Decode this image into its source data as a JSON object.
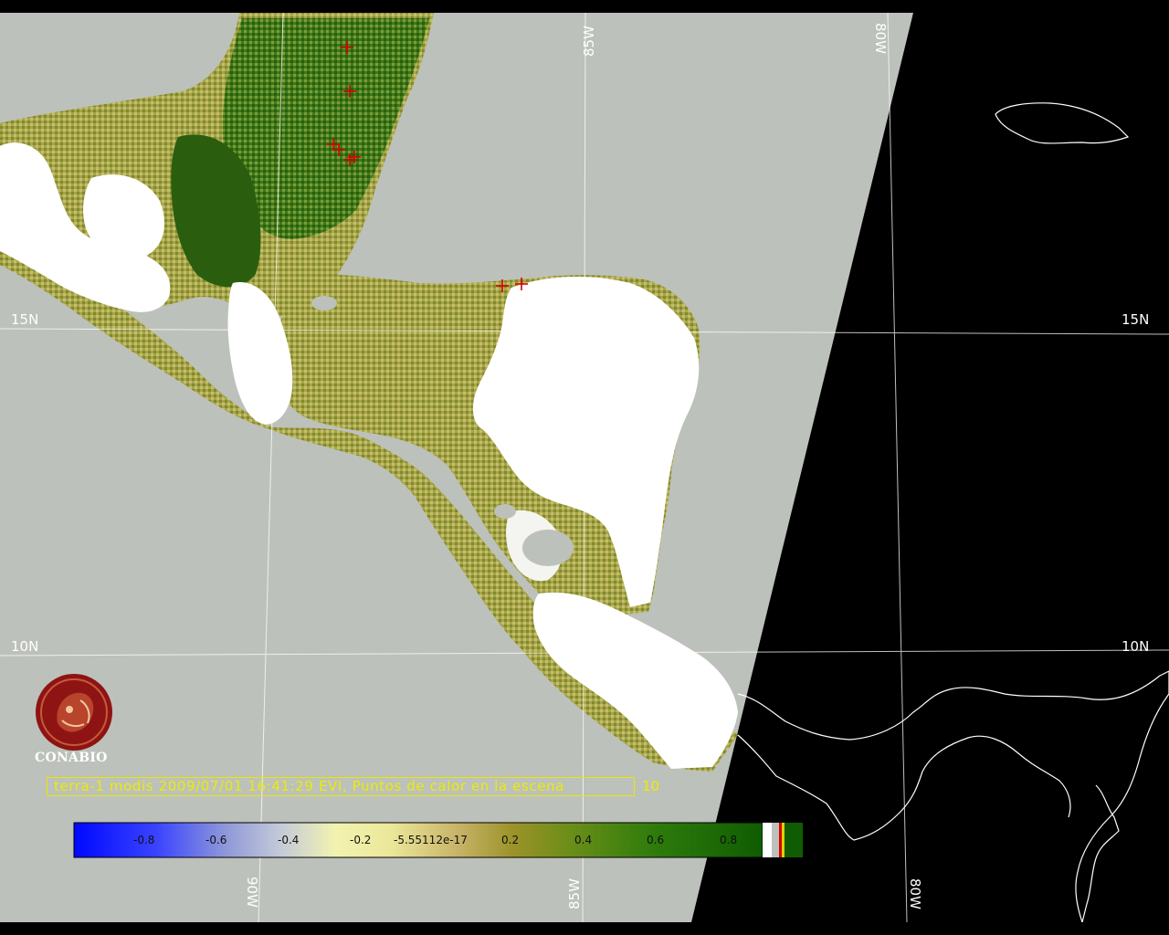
{
  "map": {
    "satellite": "terra-1",
    "sensor": "modis",
    "product": "EVI",
    "caption": "terra-1 modis 2009/07/01 16:41:29 EVI, Puntos de calor en la escena",
    "hotspot_count": "10",
    "logo_text": "CONABIO",
    "grid_labels": {
      "lat_15n_left": "15N",
      "lat_15n_right": "15N",
      "lat_10n_left": "10N",
      "lat_10n_right": "10N",
      "lon_85w_top": "85W",
      "lon_80w_top": "80W",
      "lon_90w_bottom": "90W",
      "lon_85w_bottom": "85W",
      "lon_80w_bottom": "80W"
    },
    "colorbar": {
      "ticks": [
        "-0.8",
        "-0.6",
        "-0.4",
        "-0.2",
        "-5.55112e-17",
        "0.2",
        "0.4",
        "0.6",
        "0.8"
      ]
    },
    "colors": {
      "swath": "#bdc1bb",
      "background": "#000000",
      "vegetation_dark": "#2f6a14",
      "vegetation_mid": "#8c9a3a",
      "vegetation_light": "#c9bf70",
      "cloud": "#ffffff",
      "hotspot": "#d40000",
      "caption": "#ecec00",
      "logo": "#8e1414"
    }
  }
}
